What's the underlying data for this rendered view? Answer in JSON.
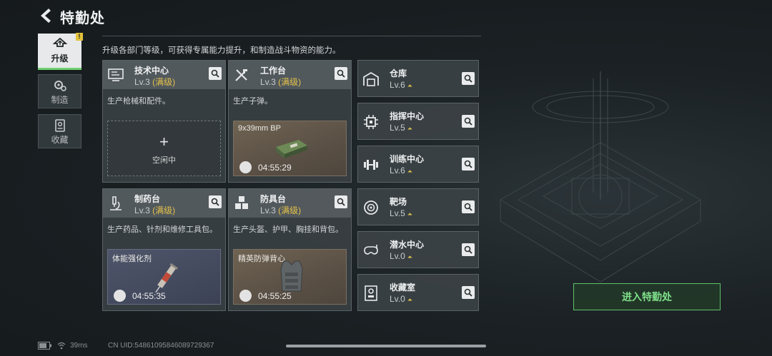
{
  "header": {
    "title": "特勤处"
  },
  "nav": [
    {
      "label": "升级",
      "icon": "upgrade-icon",
      "active": true,
      "badge": "!"
    },
    {
      "label": "制造",
      "icon": "gears-icon",
      "active": false
    },
    {
      "label": "收藏",
      "icon": "collection-icon",
      "active": false
    }
  ],
  "subtitle": "升级各部门等级，可获得专属能力提升，和制造战斗物资的能力。",
  "panels": [
    {
      "name": "技术中心",
      "level": "Lv.3",
      "max": "(满级)",
      "desc": "生产枪械和配件。",
      "slot": {
        "plus": "+",
        "label": "空闲中"
      }
    },
    {
      "name": "工作台",
      "level": "Lv.3",
      "max": "(满级)",
      "desc": "生产子弹。",
      "slot": {
        "item": "9x39mm BP",
        "timer": "04:55:29"
      }
    },
    {
      "name": "制药台",
      "level": "Lv.3",
      "max": "(满级)",
      "desc": "生产药品、针剂和维修工具包。",
      "slot": {
        "item": "体能强化剂",
        "timer": "04:55:35"
      }
    },
    {
      "name": "防具台",
      "level": "Lv.3",
      "max": "(满级)",
      "desc": "生产头盔、护甲、胸挂和背包。",
      "slot": {
        "item": "精英防弹背心",
        "timer": "04:55:25"
      }
    }
  ],
  "facilities": [
    {
      "name": "仓库",
      "level": "Lv.6",
      "icon": "warehouse-icon"
    },
    {
      "name": "指挥中心",
      "level": "Lv.5",
      "icon": "chip-icon"
    },
    {
      "name": "训练中心",
      "level": "Lv.6",
      "icon": "dumbbell-icon"
    },
    {
      "name": "靶场",
      "level": "Lv.5",
      "icon": "target-icon"
    },
    {
      "name": "潜水中心",
      "level": "Lv.0",
      "icon": "diving-mask-icon"
    },
    {
      "name": "收藏室",
      "level": "Lv.0",
      "icon": "trophy-icon"
    }
  ],
  "enter_button": "进入特勤处",
  "status": {
    "ping": "39ms",
    "uid": "CN UID:54861095846089729367"
  },
  "colors": {
    "accent": "#6fd06f",
    "max_level": "#e3c14a",
    "badge": "#e2c23b"
  }
}
